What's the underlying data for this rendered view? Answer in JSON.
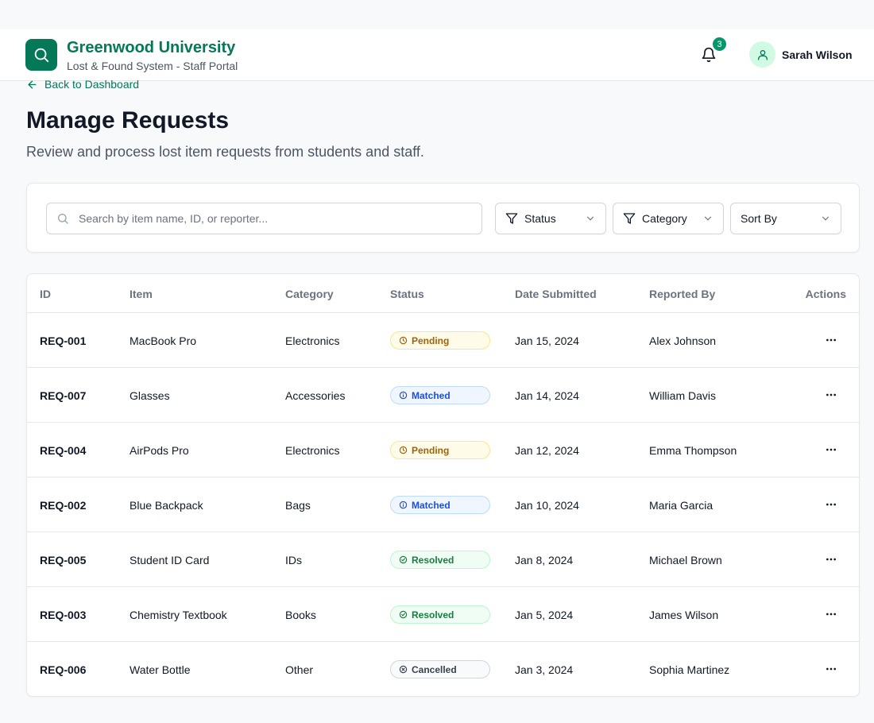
{
  "header": {
    "brand_title": "Greenwood University",
    "brand_subtitle": "Lost & Found System - Staff Portal",
    "logo_icon": "search-icon",
    "notification_count": "3",
    "user_name": "Sarah Wilson"
  },
  "nav": {
    "back_label": "Back to Dashboard"
  },
  "page": {
    "title": "Manage Requests",
    "description": "Review and process lost item requests from students and staff."
  },
  "filters": {
    "search_placeholder": "Search by item name, ID, or reporter...",
    "status_label": "Status",
    "category_label": "Category",
    "sort_label": "Sort By"
  },
  "table": {
    "columns": [
      "ID",
      "Item",
      "Category",
      "Status",
      "Date Submitted",
      "Reported By",
      "Actions"
    ],
    "rows": [
      {
        "id": "REQ-001",
        "item": "MacBook Pro",
        "category": "Electronics",
        "status": "Pending",
        "status_type": "pending",
        "date": "Jan 15, 2024",
        "reporter": "Alex Johnson"
      },
      {
        "id": "REQ-007",
        "item": "Glasses",
        "category": "Accessories",
        "status": "Matched",
        "status_type": "matched",
        "date": "Jan 14, 2024",
        "reporter": "William Davis"
      },
      {
        "id": "REQ-004",
        "item": "AirPods Pro",
        "category": "Electronics",
        "status": "Pending",
        "status_type": "pending",
        "date": "Jan 12, 2024",
        "reporter": "Emma Thompson"
      },
      {
        "id": "REQ-002",
        "item": "Blue Backpack",
        "category": "Bags",
        "status": "Matched",
        "status_type": "matched",
        "date": "Jan 10, 2024",
        "reporter": "Maria Garcia"
      },
      {
        "id": "REQ-005",
        "item": "Student ID Card",
        "category": "IDs",
        "status": "Resolved",
        "status_type": "resolved",
        "date": "Jan 8, 2024",
        "reporter": "Michael Brown"
      },
      {
        "id": "REQ-003",
        "item": "Chemistry Textbook",
        "category": "Books",
        "status": "Resolved",
        "status_type": "resolved",
        "date": "Jan 5, 2024",
        "reporter": "James Wilson"
      },
      {
        "id": "REQ-006",
        "item": "Water Bottle",
        "category": "Other",
        "status": "Cancelled",
        "status_type": "cancelled",
        "date": "Jan 3, 2024",
        "reporter": "Sophia Martinez"
      }
    ]
  },
  "colors": {
    "brand": "#047857",
    "pending": "#a16207",
    "matched": "#1d4ed8",
    "resolved": "#15803d",
    "cancelled": "#374151"
  }
}
